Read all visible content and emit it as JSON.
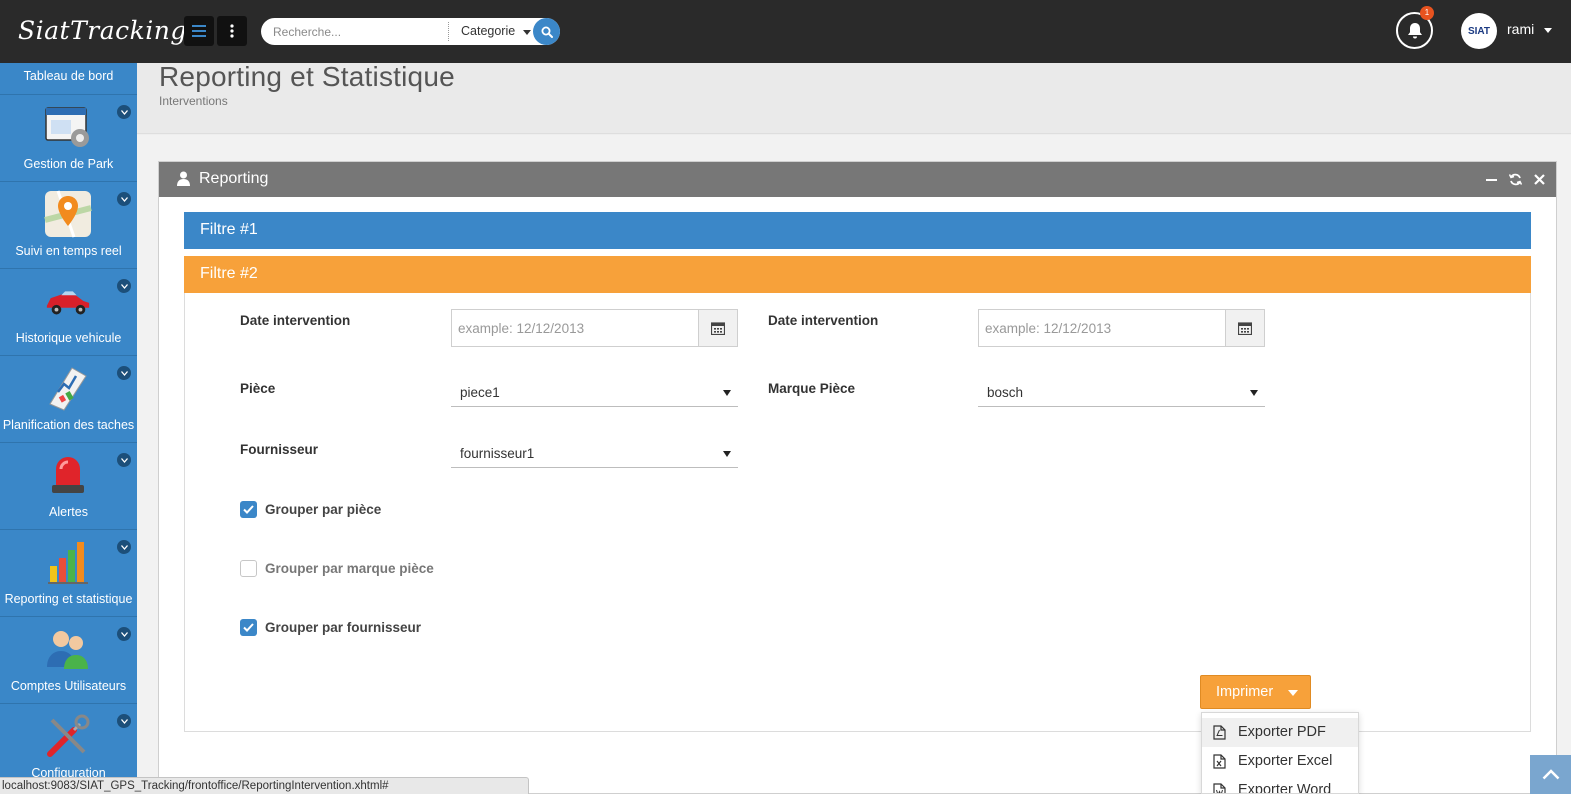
{
  "app": {
    "logo": "SiatTracking",
    "search_placeholder": "Recherche...",
    "search_category": "Categorie",
    "notification_count": "1",
    "avatar_text": "SIAT",
    "user_name": "rami"
  },
  "sidebar": {
    "items": [
      {
        "label": "Tableau de bord",
        "icon": "dashboard-icon"
      },
      {
        "label": "Gestion de Park",
        "icon": "park-management-icon"
      },
      {
        "label": "Suivi en temps reel",
        "icon": "map-pin-icon"
      },
      {
        "label": "Historique vehicule",
        "icon": "car-icon"
      },
      {
        "label": "Planification des taches",
        "icon": "planning-chart-icon"
      },
      {
        "label": "Alertes",
        "icon": "siren-icon"
      },
      {
        "label": "Reporting et statistique",
        "icon": "bar-chart-icon"
      },
      {
        "label": "Comptes Utilisateurs",
        "icon": "users-icon"
      },
      {
        "label": "Configuration",
        "icon": "tools-icon"
      }
    ]
  },
  "header": {
    "title": "Reporting et Statistique",
    "subtitle": "Interventions"
  },
  "panel": {
    "title": "Reporting"
  },
  "accordion": {
    "filter1": "Filtre #1",
    "filter2": "Filtre #2"
  },
  "form": {
    "date_label_1": "Date intervention",
    "date_label_2": "Date intervention",
    "date_placeholder": "example: 12/12/2013",
    "piece_label": "Pièce",
    "piece_value": "piece1",
    "marque_label": "Marque Pièce",
    "marque_value": "bosch",
    "fournisseur_label": "Fournisseur",
    "fournisseur_value": "fournisseur1",
    "group_piece": "Grouper par pièce",
    "group_marque": "Grouper par marque pièce",
    "group_fournisseur": "Grouper par fournisseur"
  },
  "print": {
    "label": "Imprimer",
    "items": [
      "Exporter PDF",
      "Exporter Excel",
      "Exporter Word"
    ]
  },
  "status_url": "localhost:9083/SIAT_GPS_Tracking/frontoffice/ReportingIntervention.xhtml#",
  "colors": {
    "topbar": "#2a2a2a",
    "sidebar": "#3a87c8",
    "primary": "#3b87c8",
    "accent_orange": "#f7a13a",
    "panel_header": "#777777",
    "badge": "#e8531f"
  }
}
